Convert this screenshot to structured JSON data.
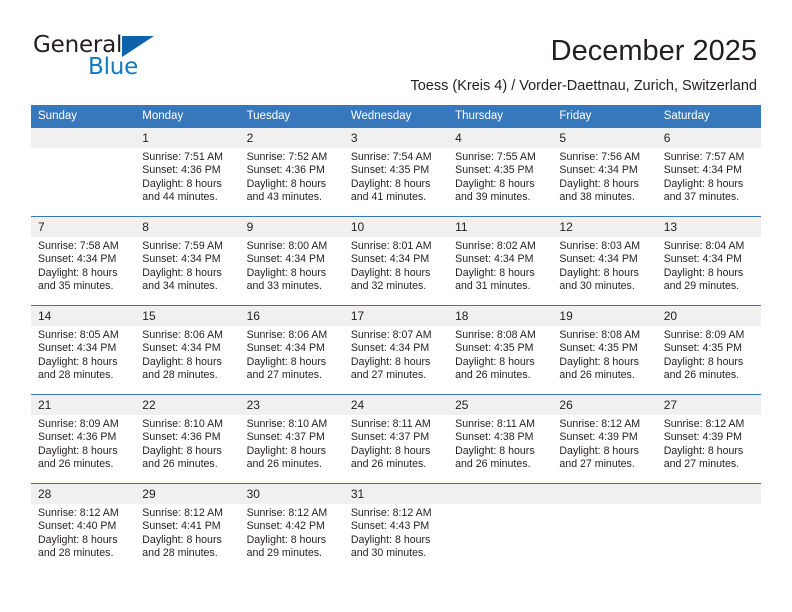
{
  "brand": {
    "name_top": "General",
    "name_bottom": "Blue",
    "accent_color": "#1063a8",
    "blue_text_color": "#1278be",
    "triangle_icon": "triangle-icon"
  },
  "header": {
    "title": "December 2025",
    "subtitle": "Toess (Kreis 4) / Vorder-Daettnau, Zurich, Switzerland"
  },
  "calendar": {
    "header_background": "#3778bc",
    "header_text_color": "#ffffff",
    "daynum_background": "#f0f0f0",
    "weekday_headers": [
      "Sunday",
      "Monday",
      "Tuesday",
      "Wednesday",
      "Thursday",
      "Friday",
      "Saturday"
    ],
    "weeks": [
      [
        {
          "day": "",
          "lines": []
        },
        {
          "day": "1",
          "lines": [
            "Sunrise: 7:51 AM",
            "Sunset: 4:36 PM",
            "Daylight: 8 hours",
            "and 44 minutes."
          ]
        },
        {
          "day": "2",
          "lines": [
            "Sunrise: 7:52 AM",
            "Sunset: 4:36 PM",
            "Daylight: 8 hours",
            "and 43 minutes."
          ]
        },
        {
          "day": "3",
          "lines": [
            "Sunrise: 7:54 AM",
            "Sunset: 4:35 PM",
            "Daylight: 8 hours",
            "and 41 minutes."
          ]
        },
        {
          "day": "4",
          "lines": [
            "Sunrise: 7:55 AM",
            "Sunset: 4:35 PM",
            "Daylight: 8 hours",
            "and 39 minutes."
          ]
        },
        {
          "day": "5",
          "lines": [
            "Sunrise: 7:56 AM",
            "Sunset: 4:34 PM",
            "Daylight: 8 hours",
            "and 38 minutes."
          ]
        },
        {
          "day": "6",
          "lines": [
            "Sunrise: 7:57 AM",
            "Sunset: 4:34 PM",
            "Daylight: 8 hours",
            "and 37 minutes."
          ]
        }
      ],
      [
        {
          "day": "7",
          "lines": [
            "Sunrise: 7:58 AM",
            "Sunset: 4:34 PM",
            "Daylight: 8 hours",
            "and 35 minutes."
          ]
        },
        {
          "day": "8",
          "lines": [
            "Sunrise: 7:59 AM",
            "Sunset: 4:34 PM",
            "Daylight: 8 hours",
            "and 34 minutes."
          ]
        },
        {
          "day": "9",
          "lines": [
            "Sunrise: 8:00 AM",
            "Sunset: 4:34 PM",
            "Daylight: 8 hours",
            "and 33 minutes."
          ]
        },
        {
          "day": "10",
          "lines": [
            "Sunrise: 8:01 AM",
            "Sunset: 4:34 PM",
            "Daylight: 8 hours",
            "and 32 minutes."
          ]
        },
        {
          "day": "11",
          "lines": [
            "Sunrise: 8:02 AM",
            "Sunset: 4:34 PM",
            "Daylight: 8 hours",
            "and 31 minutes."
          ]
        },
        {
          "day": "12",
          "lines": [
            "Sunrise: 8:03 AM",
            "Sunset: 4:34 PM",
            "Daylight: 8 hours",
            "and 30 minutes."
          ]
        },
        {
          "day": "13",
          "lines": [
            "Sunrise: 8:04 AM",
            "Sunset: 4:34 PM",
            "Daylight: 8 hours",
            "and 29 minutes."
          ]
        }
      ],
      [
        {
          "day": "14",
          "lines": [
            "Sunrise: 8:05 AM",
            "Sunset: 4:34 PM",
            "Daylight: 8 hours",
            "and 28 minutes."
          ]
        },
        {
          "day": "15",
          "lines": [
            "Sunrise: 8:06 AM",
            "Sunset: 4:34 PM",
            "Daylight: 8 hours",
            "and 28 minutes."
          ]
        },
        {
          "day": "16",
          "lines": [
            "Sunrise: 8:06 AM",
            "Sunset: 4:34 PM",
            "Daylight: 8 hours",
            "and 27 minutes."
          ]
        },
        {
          "day": "17",
          "lines": [
            "Sunrise: 8:07 AM",
            "Sunset: 4:34 PM",
            "Daylight: 8 hours",
            "and 27 minutes."
          ]
        },
        {
          "day": "18",
          "lines": [
            "Sunrise: 8:08 AM",
            "Sunset: 4:35 PM",
            "Daylight: 8 hours",
            "and 26 minutes."
          ]
        },
        {
          "day": "19",
          "lines": [
            "Sunrise: 8:08 AM",
            "Sunset: 4:35 PM",
            "Daylight: 8 hours",
            "and 26 minutes."
          ]
        },
        {
          "day": "20",
          "lines": [
            "Sunrise: 8:09 AM",
            "Sunset: 4:35 PM",
            "Daylight: 8 hours",
            "and 26 minutes."
          ]
        }
      ],
      [
        {
          "day": "21",
          "lines": [
            "Sunrise: 8:09 AM",
            "Sunset: 4:36 PM",
            "Daylight: 8 hours",
            "and 26 minutes."
          ]
        },
        {
          "day": "22",
          "lines": [
            "Sunrise: 8:10 AM",
            "Sunset: 4:36 PM",
            "Daylight: 8 hours",
            "and 26 minutes."
          ]
        },
        {
          "day": "23",
          "lines": [
            "Sunrise: 8:10 AM",
            "Sunset: 4:37 PM",
            "Daylight: 8 hours",
            "and 26 minutes."
          ]
        },
        {
          "day": "24",
          "lines": [
            "Sunrise: 8:11 AM",
            "Sunset: 4:37 PM",
            "Daylight: 8 hours",
            "and 26 minutes."
          ]
        },
        {
          "day": "25",
          "lines": [
            "Sunrise: 8:11 AM",
            "Sunset: 4:38 PM",
            "Daylight: 8 hours",
            "and 26 minutes."
          ]
        },
        {
          "day": "26",
          "lines": [
            "Sunrise: 8:12 AM",
            "Sunset: 4:39 PM",
            "Daylight: 8 hours",
            "and 27 minutes."
          ]
        },
        {
          "day": "27",
          "lines": [
            "Sunrise: 8:12 AM",
            "Sunset: 4:39 PM",
            "Daylight: 8 hours",
            "and 27 minutes."
          ]
        }
      ],
      [
        {
          "day": "28",
          "lines": [
            "Sunrise: 8:12 AM",
            "Sunset: 4:40 PM",
            "Daylight: 8 hours",
            "and 28 minutes."
          ]
        },
        {
          "day": "29",
          "lines": [
            "Sunrise: 8:12 AM",
            "Sunset: 4:41 PM",
            "Daylight: 8 hours",
            "and 28 minutes."
          ]
        },
        {
          "day": "30",
          "lines": [
            "Sunrise: 8:12 AM",
            "Sunset: 4:42 PM",
            "Daylight: 8 hours",
            "and 29 minutes."
          ]
        },
        {
          "day": "31",
          "lines": [
            "Sunrise: 8:12 AM",
            "Sunset: 4:43 PM",
            "Daylight: 8 hours",
            "and 30 minutes."
          ]
        },
        {
          "day": "",
          "lines": []
        },
        {
          "day": "",
          "lines": []
        },
        {
          "day": "",
          "lines": []
        }
      ]
    ]
  }
}
